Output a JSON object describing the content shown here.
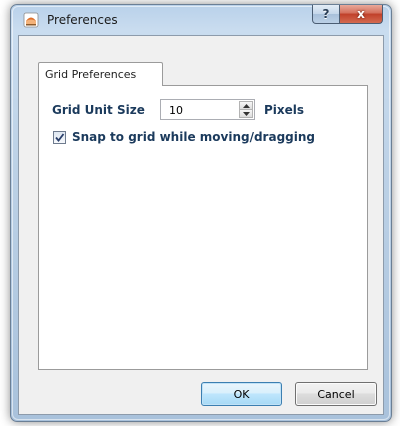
{
  "window": {
    "title": "Preferences",
    "app_icon": "preferences-app-icon"
  },
  "caption_buttons": {
    "help_label": "?",
    "close_label": "x"
  },
  "tabs": [
    {
      "label": "Grid Preferences",
      "selected": true
    }
  ],
  "grid_preferences": {
    "grid_unit_size_label": "Grid Unit Size",
    "grid_unit_size_value": "10",
    "unit_label": "Pixels",
    "snap_label": "Snap to grid while moving/dragging",
    "snap_checked": true
  },
  "buttons": {
    "ok_label": "OK",
    "cancel_label": "Cancel"
  },
  "colors": {
    "label_text": "#1b3a5c",
    "close_button": "#c0402a",
    "default_button_border": "#3c7fb1"
  }
}
